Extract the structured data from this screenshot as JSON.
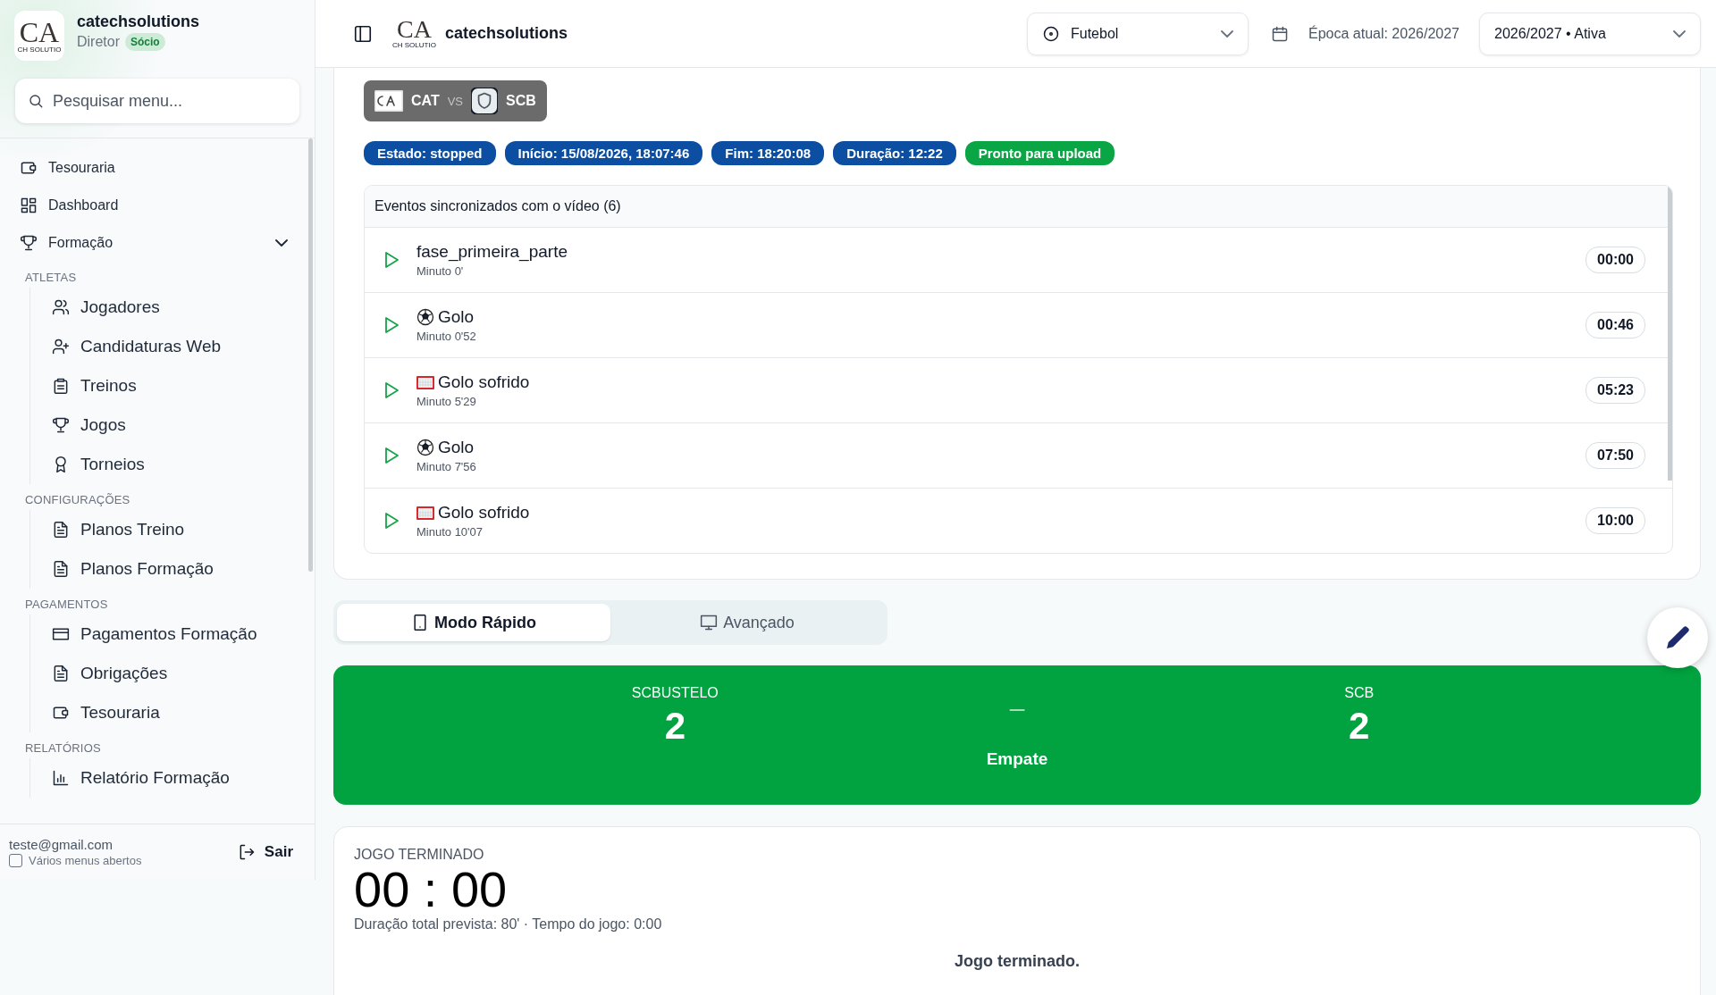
{
  "sidebar": {
    "logo": {
      "letters": "CA",
      "caption": "CH SOLUTIO"
    },
    "brand": "catechsolutions",
    "role": "Diretor",
    "badge": "Sócio",
    "search": {
      "placeholder": "Pesquisar menu..."
    },
    "items": [
      {
        "label": "Tesouraria",
        "kind": "wallet"
      },
      {
        "label": "Dashboard",
        "kind": "grid"
      },
      {
        "label": "Formação",
        "kind": "trophy",
        "expanded": true
      }
    ],
    "sections": [
      {
        "title": "ATLETAS",
        "items": [
          {
            "label": "Jogadores",
            "kind": "users"
          },
          {
            "label": "Candidaturas Web",
            "kind": "adduser"
          },
          {
            "label": "Treinos",
            "kind": "clipboard"
          },
          {
            "label": "Jogos",
            "kind": "trophy"
          },
          {
            "label": "Torneios",
            "kind": "award"
          }
        ]
      },
      {
        "title": "CONFIGURAÇÕES",
        "items": [
          {
            "label": "Planos Treino",
            "kind": "file"
          },
          {
            "label": "Planos Formação",
            "kind": "file"
          }
        ]
      },
      {
        "title": "PAGAMENTOS",
        "items": [
          {
            "label": "Pagamentos Formação",
            "kind": "card"
          },
          {
            "label": "Obrigações",
            "kind": "file"
          },
          {
            "label": "Tesouraria",
            "kind": "wallet"
          }
        ]
      },
      {
        "title": "RELATÓRIOS",
        "items": [
          {
            "label": "Relatório Formação",
            "kind": "chart"
          }
        ]
      }
    ],
    "footer": {
      "email": "teste@gmail.com",
      "option": {
        "label": "Vários menus abertos",
        "checked": false
      },
      "logout": "Sair"
    }
  },
  "topbar": {
    "logo": {
      "letters": "CA",
      "caption": "CH SOLUTIO"
    },
    "brand": "catechsolutions",
    "sport": "Futebol",
    "season_label": "Época atual: 2026/2027",
    "season_select": "2026/2027 • Ativa"
  },
  "match": {
    "home": "CAT",
    "vs": "VS",
    "away": "SCB"
  },
  "badges": [
    {
      "text": "Estado: stopped",
      "color": "#0b4ea2"
    },
    {
      "text": "Início: 15/08/2026, 18:07:46",
      "color": "#0b4ea2"
    },
    {
      "text": "Fim: 18:20:08",
      "color": "#0b4ea2"
    },
    {
      "text": "Duração: 12:22",
      "color": "#0b4ea2"
    },
    {
      "text": "Pronto para upload",
      "color": "#0aa544"
    }
  ],
  "events": {
    "title": "Eventos sincronizados com o vídeo (6)",
    "items": [
      {
        "kind": "phase",
        "title": "fase_primeira_parte",
        "minute": "Minuto 0'",
        "time": "00:00"
      },
      {
        "kind": "goal",
        "title": "Golo",
        "minute": "Minuto 0'52",
        "time": "00:46"
      },
      {
        "kind": "conceded",
        "title": "Golo sofrido",
        "minute": "Minuto 5'29",
        "time": "05:23"
      },
      {
        "kind": "goal",
        "title": "Golo",
        "minute": "Minuto 7'56",
        "time": "07:50"
      },
      {
        "kind": "conceded",
        "title": "Golo sofrido",
        "minute": "Minuto 10'07",
        "time": "10:00"
      }
    ]
  },
  "modes": [
    {
      "label": "Modo Rápido",
      "kind": "tablet",
      "selected": true
    },
    {
      "label": "Avançado",
      "kind": "monitor",
      "selected": false
    }
  ],
  "score": {
    "home_name": "SCBUSTELO",
    "home_score": "2",
    "separator": "–",
    "away_name": "SCB",
    "away_score": "2",
    "result": "Empate"
  },
  "timer": {
    "label": "JOGO TERMINADO",
    "time": "00 : 00",
    "details": "Duração total prevista: 80' · Tempo do jogo: 0:00",
    "message": "Jogo terminado."
  }
}
